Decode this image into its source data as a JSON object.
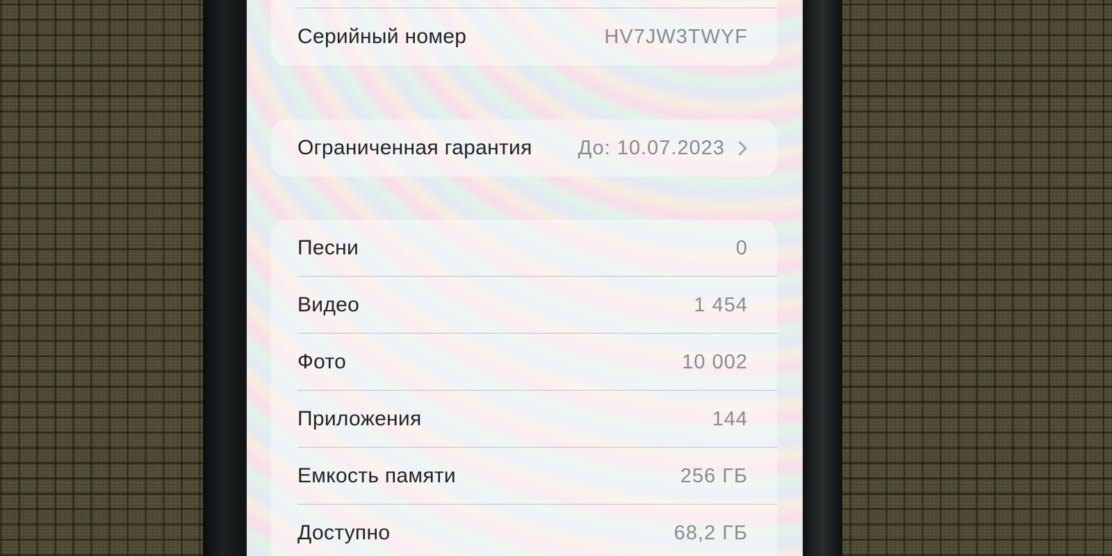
{
  "about": {
    "top_row": {
      "value": ""
    },
    "serial": {
      "label": "Серийный номер",
      "value": "HV7JW3TWYF"
    },
    "warranty": {
      "label": "Ограниченная гарантия",
      "value": "До: 10.07.2023",
      "icon": "chevron-right-icon"
    },
    "media": [
      {
        "label": "Песни",
        "value": "0"
      },
      {
        "label": "Видео",
        "value": "1 454"
      },
      {
        "label": "Фото",
        "value": "10 002"
      },
      {
        "label": "Приложения",
        "value": "144"
      },
      {
        "label": "Емкость памяти",
        "value": "256 ГБ"
      },
      {
        "label": "Доступно",
        "value": "68,2 ГБ"
      }
    ]
  }
}
